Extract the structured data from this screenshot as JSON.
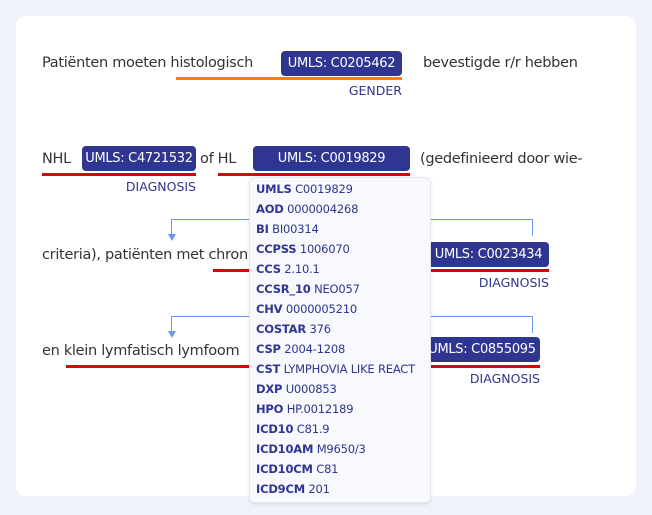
{
  "lines": {
    "l1_before": "Patiënten moeten histologisch",
    "l1_chip": "UMLS: C0205462",
    "l1_after": "bevestigde r/r hebben",
    "l1_label": "GENDER",
    "l2_a": "NHL",
    "l2_chip1": "UMLS: C4721532",
    "l2_b": "of HL",
    "l2_chip2": "UMLS: C0019829",
    "l2_c": "(gedefinieerd door wie-",
    "l2_label": "DIAGNOSIS",
    "l3_a": "criteria), patiënten met chron",
    "l3_chip": "UMLS: C0023434",
    "l3_label": "DIAGNOSIS",
    "l4_a": "en klein lymfatisch lymfoom",
    "l4_chip": "UMLS: C0855095",
    "l4_label": "DIAGNOSIS"
  },
  "colors": {
    "chip": "#2f3590",
    "gender_underline": "#ff7f00",
    "diagnosis_underline": "#e00000",
    "relation": "#6699ee"
  },
  "dropdown": [
    {
      "source": "UMLS",
      "code": "C0019829"
    },
    {
      "source": "AOD",
      "code": "0000004268"
    },
    {
      "source": "BI",
      "code": "BI00314"
    },
    {
      "source": "CCPSS",
      "code": "1006070"
    },
    {
      "source": "CCS",
      "code": "2.10.1"
    },
    {
      "source": "CCSR_10",
      "code": "NEO057"
    },
    {
      "source": "CHV",
      "code": "0000005210"
    },
    {
      "source": "COSTAR",
      "code": "376"
    },
    {
      "source": "CSP",
      "code": "2004-1208"
    },
    {
      "source": "CST",
      "code": "LYMPHOVIA LIKE REACT"
    },
    {
      "source": "DXP",
      "code": "U000853"
    },
    {
      "source": "HPO",
      "code": "HP.0012189"
    },
    {
      "source": "ICD10",
      "code": "C81.9"
    },
    {
      "source": "ICD10AM",
      "code": "M9650/3"
    },
    {
      "source": "ICD10CM",
      "code": "C81"
    },
    {
      "source": "ICD9CM",
      "code": "201"
    }
  ]
}
